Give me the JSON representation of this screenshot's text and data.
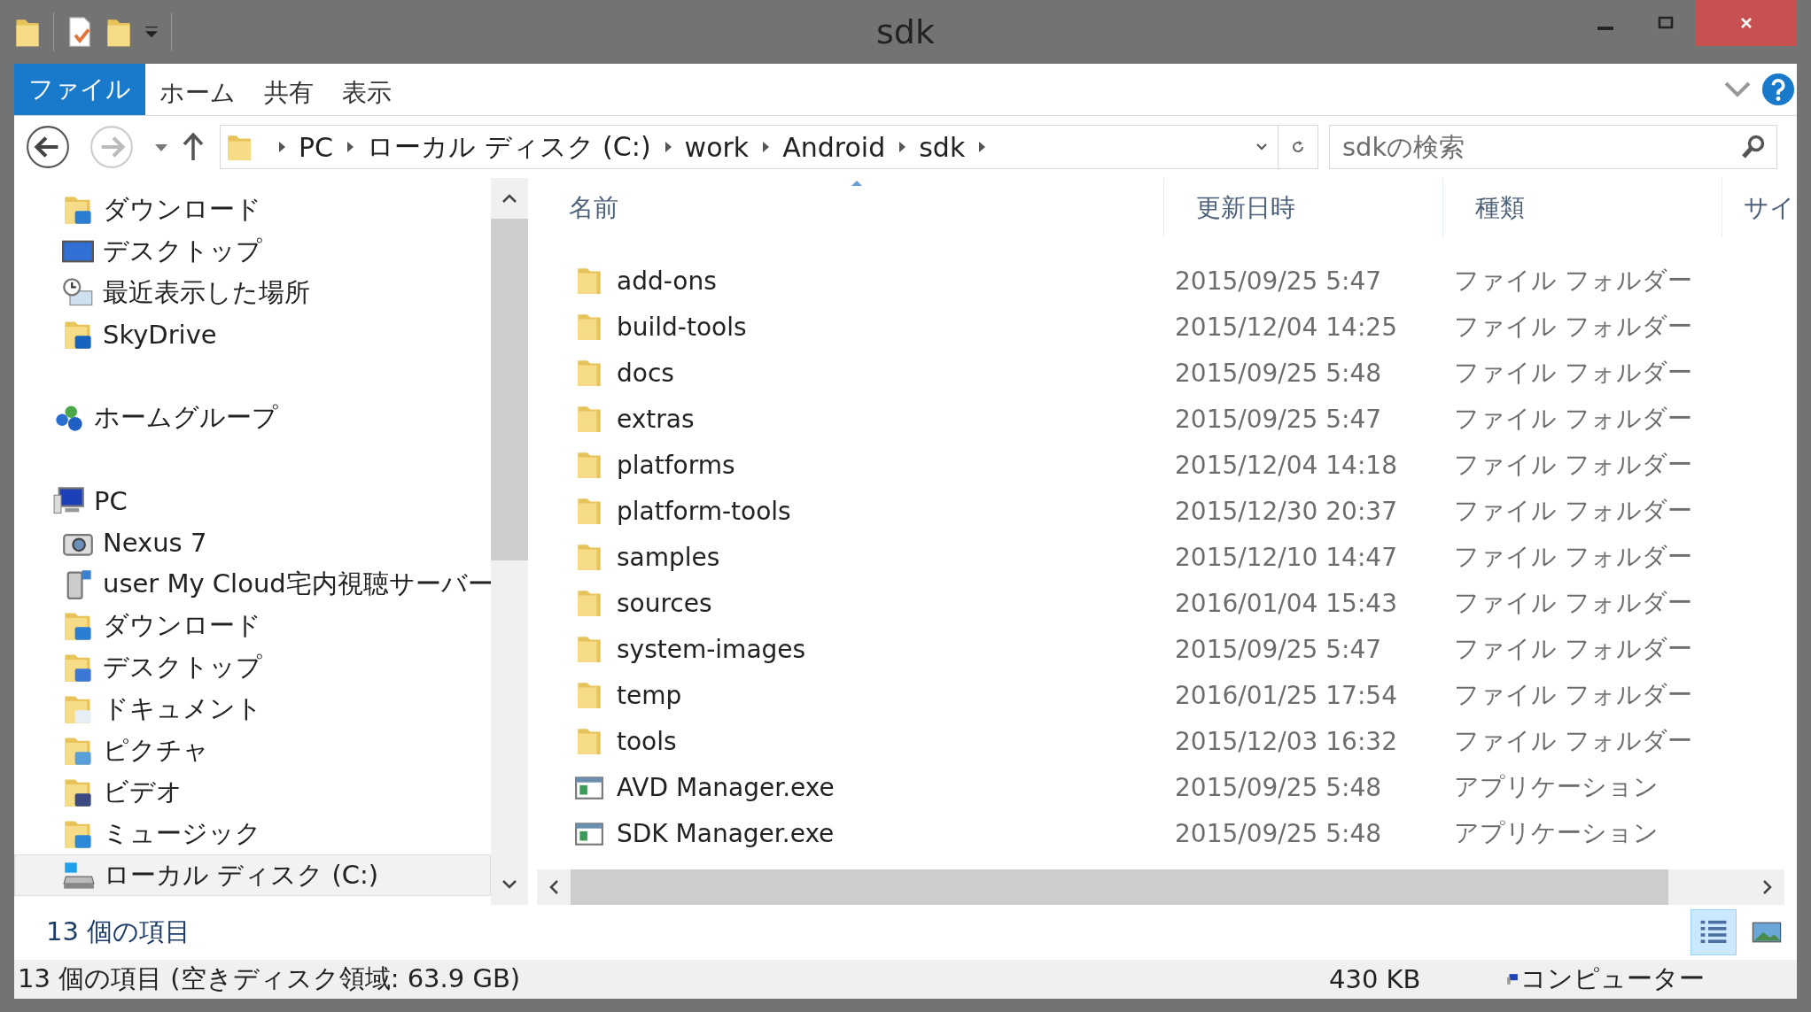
{
  "window": {
    "title": "sdk"
  },
  "ribbon": {
    "tabs": [
      {
        "label": "ファイル",
        "selected": true
      },
      {
        "label": "ホーム",
        "selected": false
      },
      {
        "label": "共有",
        "selected": false
      },
      {
        "label": "表示",
        "selected": false
      }
    ]
  },
  "address": {
    "segments": [
      "PC",
      "ローカル ディスク (C:)",
      "work",
      "Android",
      "sdk"
    ]
  },
  "search": {
    "placeholder": "sdkの検索"
  },
  "nav": {
    "groups": [
      {
        "items": [
          {
            "label": "ダウンロード",
            "kind": "download",
            "selected": false
          },
          {
            "label": "デスクトップ",
            "kind": "desktop",
            "selected": false
          },
          {
            "label": "最近表示した場所",
            "kind": "recent",
            "selected": false
          },
          {
            "label": "SkyDrive",
            "kind": "cloud",
            "selected": false
          }
        ]
      },
      {
        "items": [
          {
            "label": "ホームグループ",
            "kind": "homegroup",
            "selected": false
          }
        ]
      },
      {
        "items": [
          {
            "label": "PC",
            "kind": "pc",
            "selected": false,
            "children": [
              {
                "label": "Nexus 7",
                "kind": "camera",
                "selected": false
              },
              {
                "label": "user My Cloud宅内視聴サーバー",
                "kind": "server",
                "selected": false
              },
              {
                "label": "ダウンロード",
                "kind": "download",
                "selected": false
              },
              {
                "label": "デスクトップ",
                "kind": "desktopfolder",
                "selected": false
              },
              {
                "label": "ドキュメント",
                "kind": "documents",
                "selected": false
              },
              {
                "label": "ピクチャ",
                "kind": "pictures",
                "selected": false
              },
              {
                "label": "ビデオ",
                "kind": "videos",
                "selected": false
              },
              {
                "label": "ミュージック",
                "kind": "music",
                "selected": false
              },
              {
                "label": "ローカル ディスク (C:)",
                "kind": "drive",
                "selected": true
              }
            ]
          }
        ]
      }
    ]
  },
  "files": {
    "columns": [
      {
        "label": "名前",
        "sorted": true
      },
      {
        "label": "更新日時",
        "sorted": false
      },
      {
        "label": "種類",
        "sorted": false
      },
      {
        "label": "サイ",
        "sorted": false
      }
    ],
    "rows": [
      {
        "kind": "folder",
        "name": "add-ons",
        "date": "2015/09/25 5:47",
        "type": "ファイル フォルダー"
      },
      {
        "kind": "folder",
        "name": "build-tools",
        "date": "2015/12/04 14:25",
        "type": "ファイル フォルダー"
      },
      {
        "kind": "folder",
        "name": "docs",
        "date": "2015/09/25 5:48",
        "type": "ファイル フォルダー"
      },
      {
        "kind": "folder",
        "name": "extras",
        "date": "2015/09/25 5:47",
        "type": "ファイル フォルダー"
      },
      {
        "kind": "folder",
        "name": "platforms",
        "date": "2015/12/04 14:18",
        "type": "ファイル フォルダー"
      },
      {
        "kind": "folder",
        "name": "platform-tools",
        "date": "2015/12/30 20:37",
        "type": "ファイル フォルダー"
      },
      {
        "kind": "folder",
        "name": "samples",
        "date": "2015/12/10 14:47",
        "type": "ファイル フォルダー"
      },
      {
        "kind": "folder",
        "name": "sources",
        "date": "2016/01/04 15:43",
        "type": "ファイル フォルダー"
      },
      {
        "kind": "folder",
        "name": "system-images",
        "date": "2015/09/25 5:47",
        "type": "ファイル フォルダー"
      },
      {
        "kind": "folder",
        "name": "temp",
        "date": "2016/01/25 17:54",
        "type": "ファイル フォルダー"
      },
      {
        "kind": "folder",
        "name": "tools",
        "date": "2015/12/03 16:32",
        "type": "ファイル フォルダー"
      },
      {
        "kind": "app",
        "name": "AVD Manager.exe",
        "date": "2015/09/25 5:48",
        "type": "アプリケーション"
      },
      {
        "kind": "app",
        "name": "SDK Manager.exe",
        "date": "2015/09/25 5:48",
        "type": "アプリケーション"
      }
    ]
  },
  "item_count": "13 個の項目",
  "views": [
    {
      "kind": "details",
      "selected": true
    },
    {
      "kind": "large",
      "selected": false
    }
  ],
  "status_bar": {
    "summary": "13 個の項目 (空きディスク領域: 63.9 GB)",
    "size": "430 KB",
    "zone": "コンピューター"
  }
}
